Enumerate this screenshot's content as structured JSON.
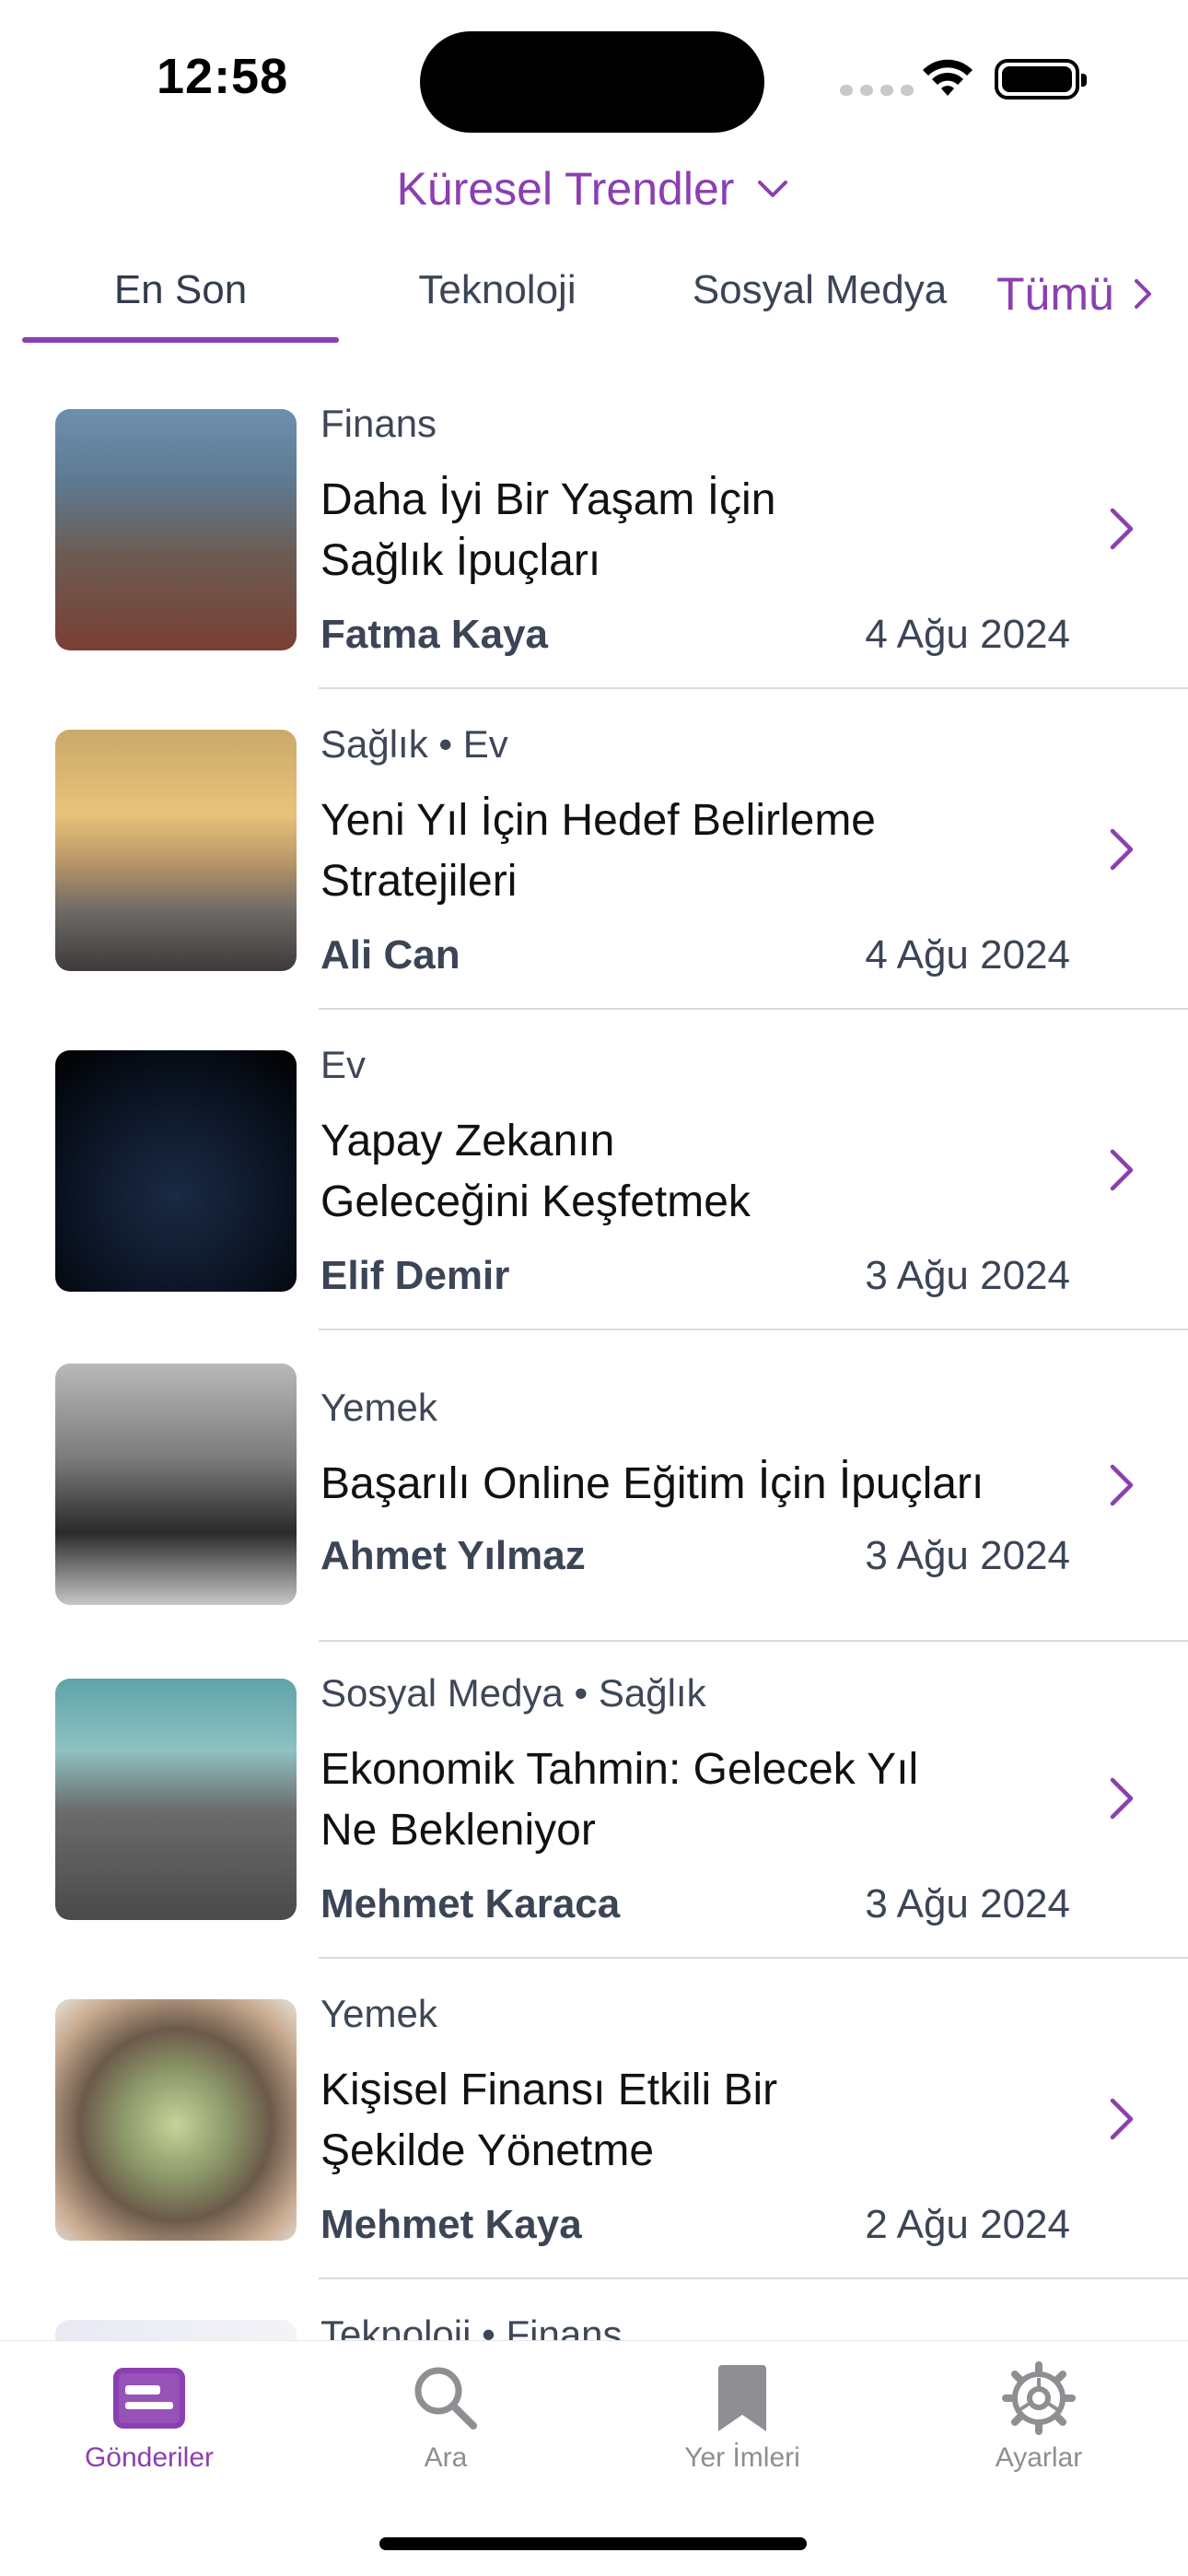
{
  "status_bar": {
    "time": "12:58"
  },
  "header": {
    "region_label": "Küresel Trendler"
  },
  "tabs": {
    "items": [
      {
        "label": "En Son",
        "active": true
      },
      {
        "label": "Teknoloji",
        "active": false
      },
      {
        "label": "Sosyal Medya",
        "active": false
      }
    ],
    "all_label": "Tümü"
  },
  "posts": [
    {
      "category": "Finans",
      "title_lines": [
        "Daha İyi Bir Yaşam İçin",
        "Sağlık İpuçları"
      ],
      "author": "Fatma Kaya",
      "date": "4 Ağu 2024"
    },
    {
      "category": "Sağlık • Ev",
      "title_lines": [
        "Yeni Yıl İçin Hedef Belirleme",
        "Stratejileri"
      ],
      "author": "Ali Can",
      "date": "4 Ağu 2024"
    },
    {
      "category": "Ev",
      "title_lines": [
        "Yapay Zekanın",
        "Geleceğini Keşfetmek"
      ],
      "author": "Elif Demir",
      "date": "3 Ağu 2024"
    },
    {
      "category": "Yemek",
      "title_lines": [
        "Başarılı Online Eğitim İçin İpuçları"
      ],
      "author": "Ahmet Yılmaz",
      "date": "3 Ağu 2024"
    },
    {
      "category": "Sosyal Medya • Sağlık",
      "title_lines": [
        "Ekonomik Tahmin: Gelecek Yıl",
        "Ne Bekleniyor"
      ],
      "author": "Mehmet Karaca",
      "date": "3 Ağu 2024"
    },
    {
      "category": "Yemek",
      "title_lines": [
        "Kişisel Finansı Etkili Bir",
        "Şekilde Yönetme"
      ],
      "author": "Mehmet Kaya",
      "date": "2 Ağu 2024"
    },
    {
      "category": "Teknoloji • Finans"
    }
  ],
  "tab_bar": {
    "items": [
      {
        "label": "Gönderiler",
        "icon": "posts-icon",
        "active": true
      },
      {
        "label": "Ara",
        "icon": "search-icon",
        "active": false
      },
      {
        "label": "Yer İmleri",
        "icon": "bookmark-icon",
        "active": false
      },
      {
        "label": "Ayarlar",
        "icon": "gear-icon",
        "active": false
      }
    ]
  },
  "colors": {
    "accent": "#8c3fb0",
    "secondary_text": "#3b4556",
    "inactive": "#8e8e93"
  }
}
